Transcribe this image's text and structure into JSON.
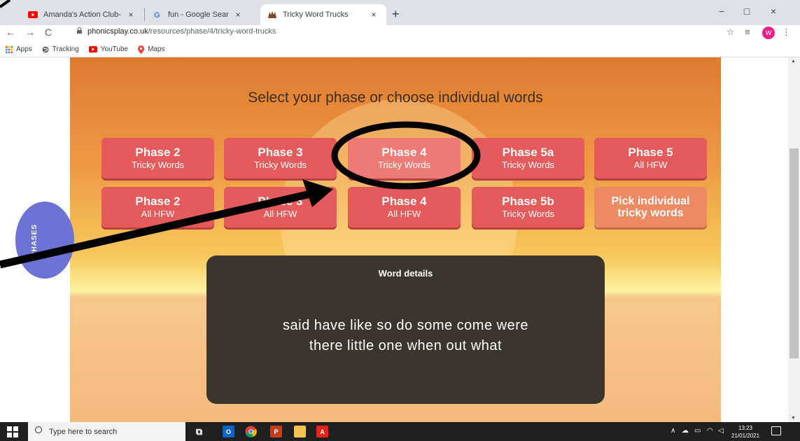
{
  "browser": {
    "tabs": [
      {
        "title": "Amanda's Action Club- Warm Up",
        "icon": "youtube-icon",
        "close": "×"
      },
      {
        "title": "fun - Google Search",
        "icon": "google-icon",
        "close": "×"
      },
      {
        "title": "Tricky Word Trucks",
        "icon": "phonicsplay-icon",
        "close": "×",
        "active": true
      }
    ],
    "new_tab": "+",
    "window_controls": {
      "minimize": "−",
      "maximize": "□",
      "close": "×"
    },
    "nav": {
      "back": "←",
      "forward": "→",
      "reload": "C"
    },
    "url_host": "phonicsplay.co.uk",
    "url_path": "/resources/phase/4/tricky-word-trucks",
    "star": "☆",
    "reading_list": "≡",
    "profile_initial": "W",
    "menu": "⋮",
    "bookmarks": [
      {
        "label": "Apps",
        "icon": "apps-grid-icon"
      },
      {
        "label": "Tracking",
        "icon": "globe-icon"
      },
      {
        "label": "YouTube",
        "icon": "youtube-icon"
      },
      {
        "label": "Maps",
        "icon": "maps-pin-icon"
      }
    ]
  },
  "game": {
    "heading": "Select your phase or choose individual words",
    "buttons_row1": [
      {
        "line1": "Phase 2",
        "line2": "Tricky Words"
      },
      {
        "line1": "Phase 3",
        "line2": "Tricky Words"
      },
      {
        "line1": "Phase 4",
        "line2": "Tricky Words",
        "selected": true
      },
      {
        "line1": "Phase 5a",
        "line2": "Tricky Words"
      },
      {
        "line1": "Phase 5",
        "line2": "All HFW"
      }
    ],
    "buttons_row2": [
      {
        "line1": "Phase 2",
        "line2": "All HFW"
      },
      {
        "line1": "Phase 3",
        "line2": "All HFW"
      },
      {
        "line1": "Phase 4",
        "line2": "All HFW"
      },
      {
        "line1": "Phase 5b",
        "line2": "Tricky Words"
      },
      {
        "line1": "Pick individual",
        "line2": "tricky words"
      }
    ],
    "details_title": "Word details",
    "words_line1": "said have like so do some come were",
    "words_line2": "there little one when out what",
    "phases_tab": "PHASES"
  },
  "taskbar": {
    "search_placeholder": "Type here to search",
    "apps": [
      {
        "icon": "task-view-icon",
        "label": "⧉"
      },
      {
        "icon": "outlook-icon",
        "label": "O"
      },
      {
        "icon": "chrome-icon",
        "label": ""
      },
      {
        "icon": "powerpoint-icon",
        "label": "P"
      },
      {
        "icon": "file-explorer-icon",
        "label": ""
      },
      {
        "icon": "acrobat-icon",
        "label": "A"
      }
    ],
    "tray": "∧",
    "time": "13:23",
    "date": "21/01/2021"
  },
  "colors": {
    "button_red": "#e55a5a",
    "button_selected": "#ee7a76",
    "button_pick": "#ee8a62",
    "details_bg": "#3a352f",
    "phases_tab": "#6b74d4"
  }
}
